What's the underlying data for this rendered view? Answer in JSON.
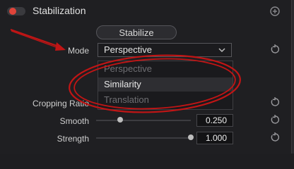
{
  "header": {
    "title": "Stabilization",
    "enabled": true,
    "accent": "#e0443a"
  },
  "stabilize_button": {
    "label": "Stabilize"
  },
  "mode": {
    "label": "Mode",
    "value": "Perspective",
    "options": [
      {
        "label": "Perspective",
        "state": "disabled"
      },
      {
        "label": "Similarity",
        "state": "selected"
      },
      {
        "label": "Translation",
        "state": "disabled"
      }
    ]
  },
  "cropping": {
    "label": "Cropping Ratio"
  },
  "smooth": {
    "label": "Smooth",
    "value": "0.250",
    "level": 0.25
  },
  "strength": {
    "label": "Strength",
    "value": "1.000",
    "level": 1.0
  },
  "annotation": {
    "color": "#c11515"
  }
}
